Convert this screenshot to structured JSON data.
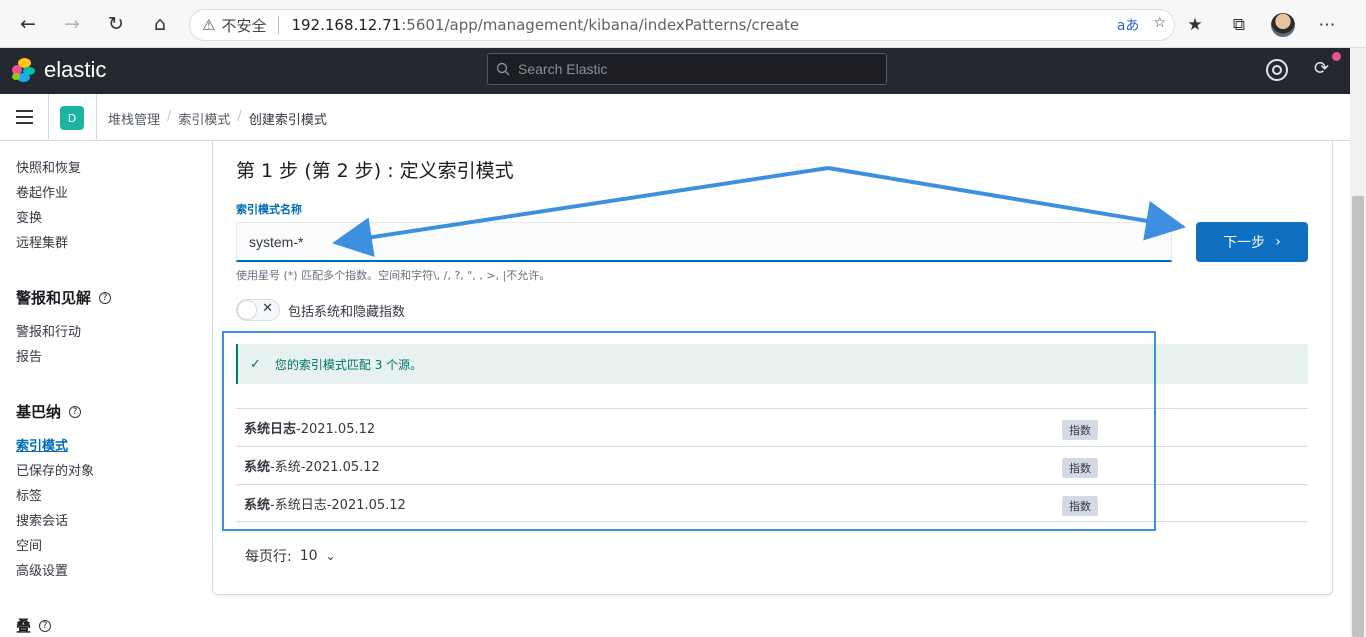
{
  "browser": {
    "insecure_label": "不安全",
    "url_host": "192.168.12.71",
    "url_path": ":5601/app/management/kibana/indexPatterns/create",
    "read_aloud_icon": "aあ"
  },
  "header": {
    "brand": "elastic",
    "search_placeholder": "Search Elastic"
  },
  "breadcrumb": {
    "space_initial": "D",
    "items": [
      "堆栈管理",
      "索引模式",
      "创建索引模式"
    ]
  },
  "sidebar": {
    "items_top": [
      "快照和恢复",
      "卷起作业",
      "变换",
      "远程集群"
    ],
    "alerts_heading": "警报和见解",
    "alerts_items": [
      "警报和行动",
      "报告"
    ],
    "kibana_heading": "基巴纳",
    "kibana_items": [
      "索引模式",
      "已保存的对象",
      "标签",
      "搜索会话",
      "空间",
      "高级设置"
    ],
    "stack_heading": "叠"
  },
  "main": {
    "step_title": "第 1 步 (第 2 步) : 定义索引模式",
    "field_label": "索引模式名称",
    "field_value": "system-*",
    "help_text": "使用星号 (*) 匹配多个指数。空间和字符\\, /, ?, \", , >, |不允许。",
    "next_button": "下一步",
    "toggle_label": "包括系统和隐藏指数",
    "callout_text": "您的索引模式匹配 3 个源。",
    "indices": [
      {
        "name_bold": "系统日志",
        "name_rest": "-2021.05.12",
        "badge": "指数"
      },
      {
        "name_bold": "系统",
        "name_rest": "-系统-2021.05.12",
        "badge": "指数"
      },
      {
        "name_bold": "系统",
        "name_rest": "-系统日志-2021.05.12",
        "badge": "指数"
      }
    ],
    "per_page_label": "每页行:",
    "per_page_value": "10"
  },
  "colors": {
    "primary": "#0f6fc0",
    "header_bg": "#25282f",
    "success": "#017d73",
    "annotation": "#3d8fe0"
  }
}
